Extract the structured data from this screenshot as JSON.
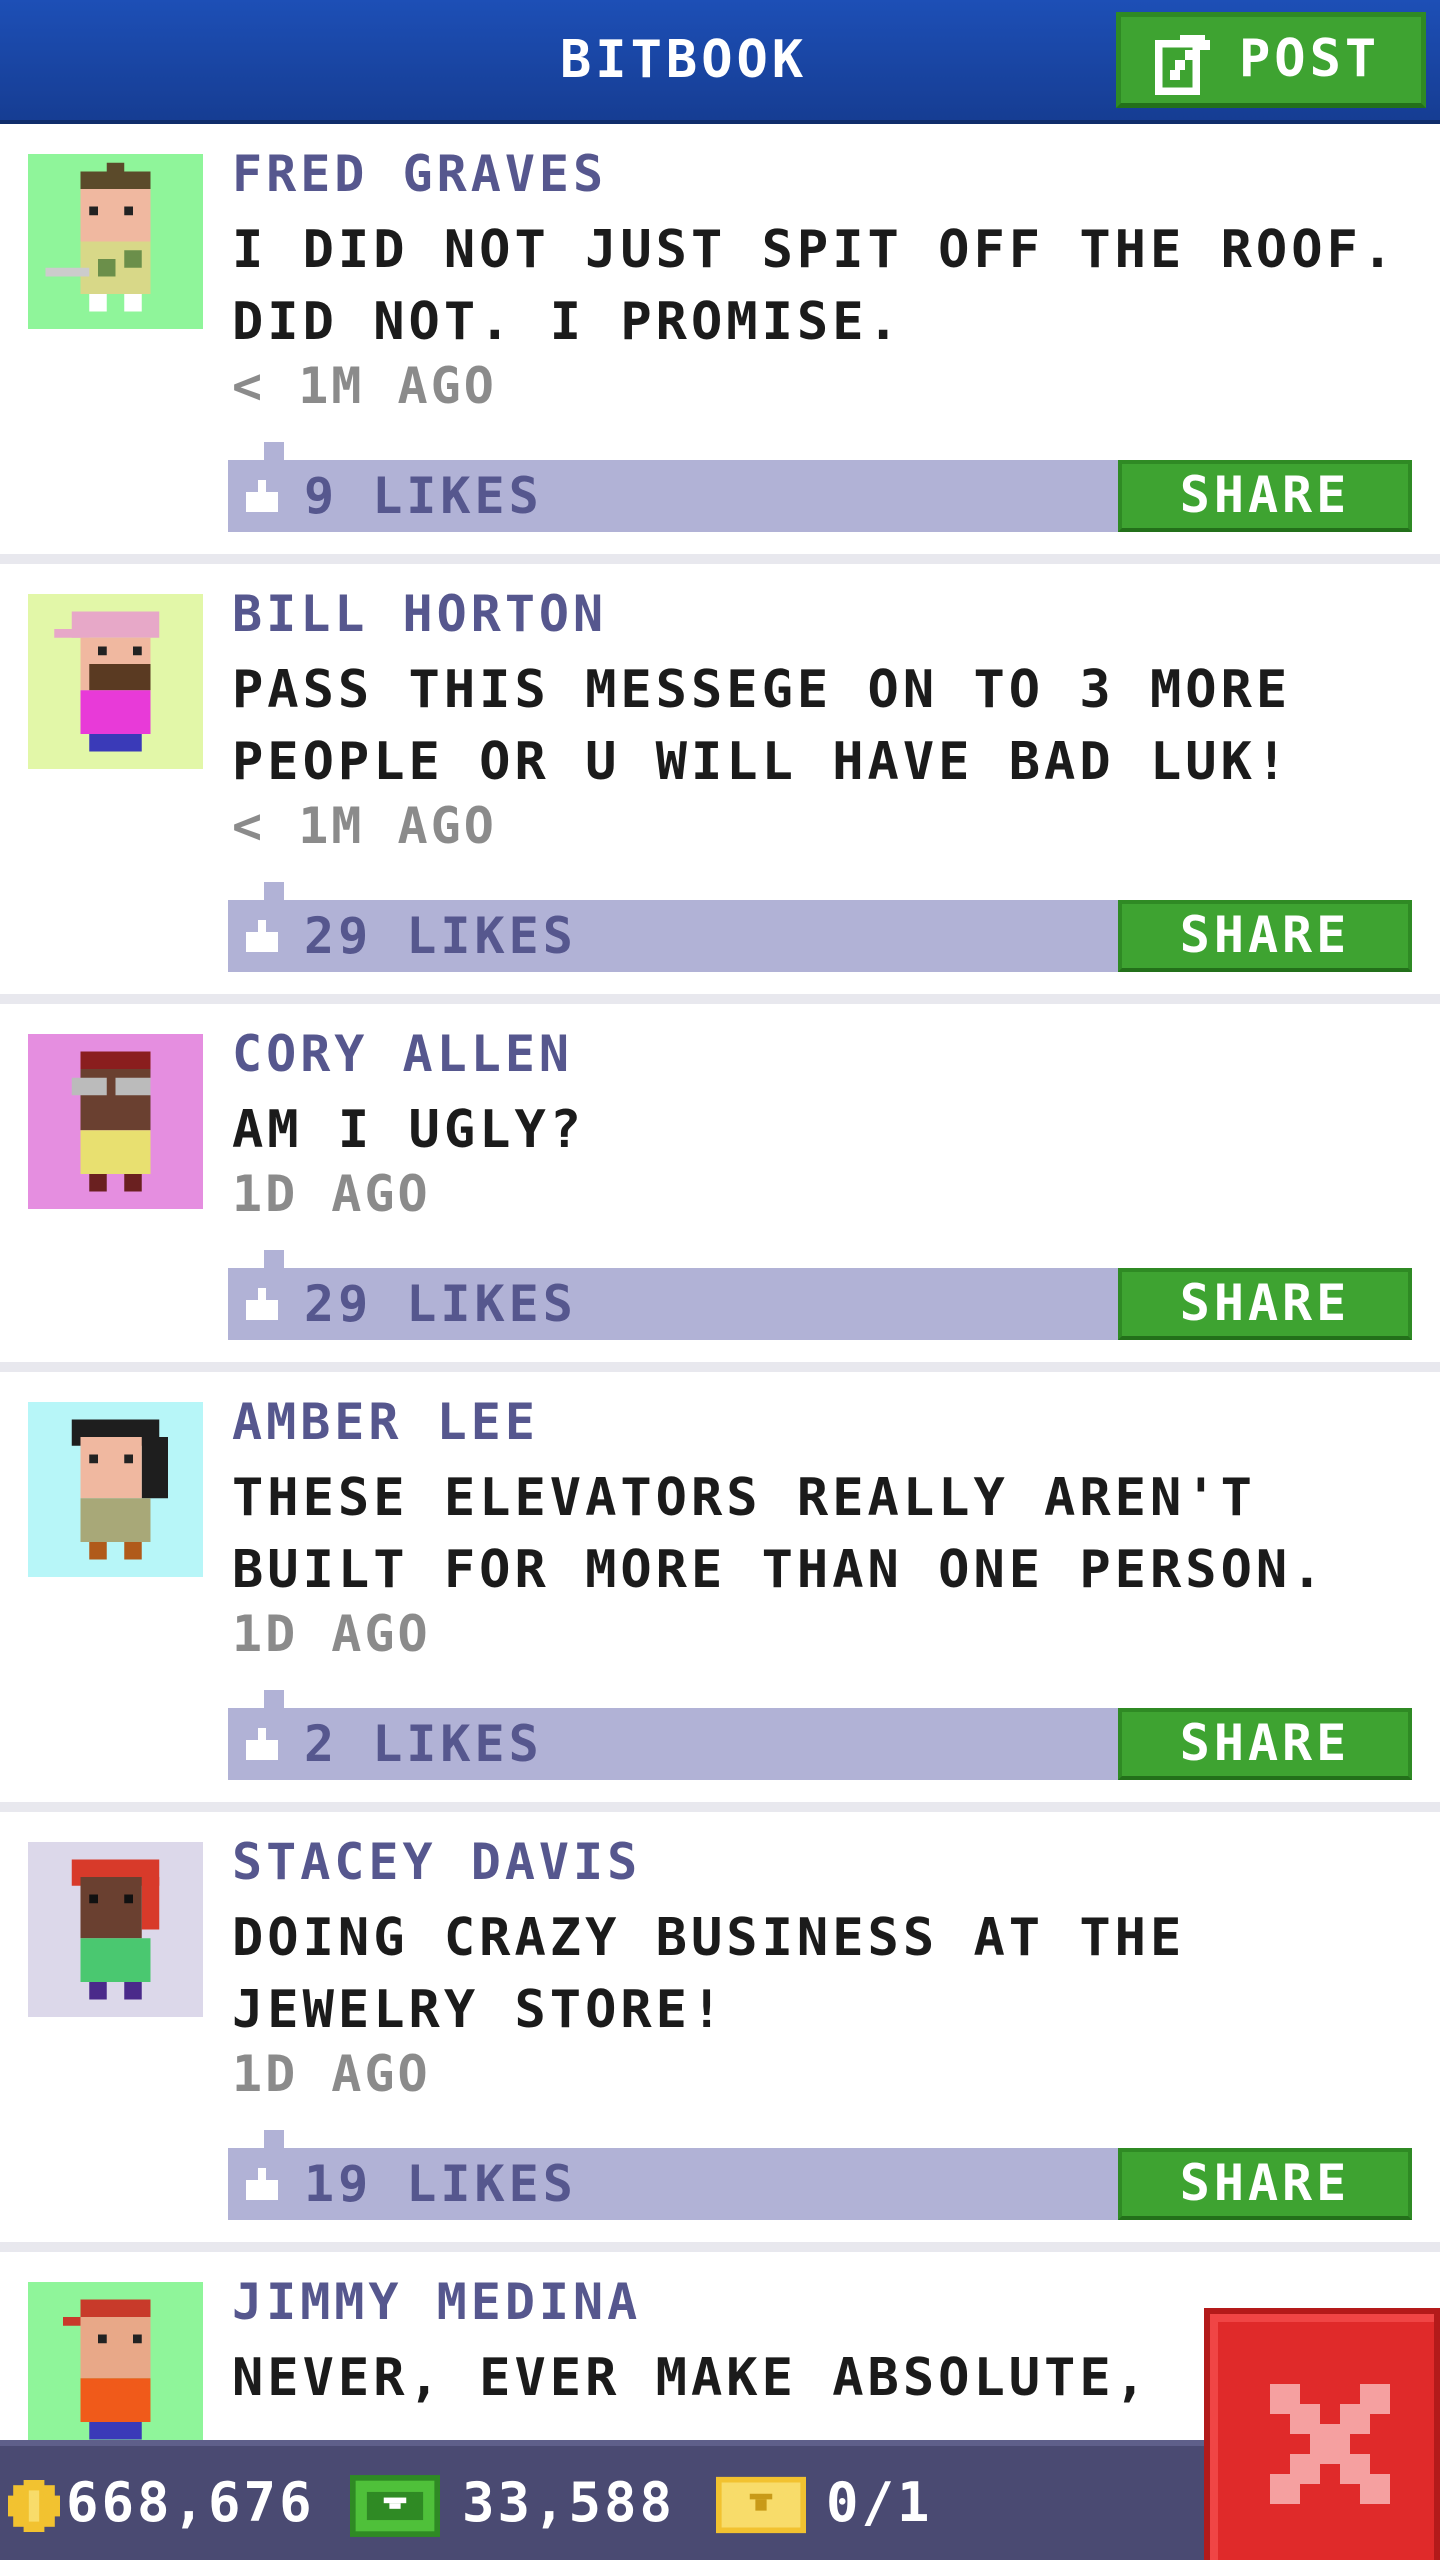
{
  "header": {
    "title": "BITBOOK",
    "post_label": "POST"
  },
  "colors": {
    "header_blue": "#1d4fb6",
    "accent_green": "#3ea331",
    "name_purple": "#56578e",
    "like_bar": "#b1b2d6",
    "close_red": "#e02a2a"
  },
  "posts": [
    {
      "author": "FRED GRAVES",
      "message": "I DID NOT JUST SPIT OFF THE ROOF. DID NOT. I PROMISE.",
      "time": "< 1M AGO",
      "likes": "9 LIKES",
      "share_label": "SHARE",
      "avatar_bg": "#8ff59a"
    },
    {
      "author": "BILL HORTON",
      "message": "PASS THIS MESSEGE ON TO 3 MORE PEOPLE OR U WILL HAVE BAD LUK!",
      "time": "< 1M AGO",
      "likes": "29 LIKES",
      "share_label": "SHARE",
      "avatar_bg": "#e2f7a8"
    },
    {
      "author": "CORY ALLEN",
      "message": "AM I UGLY?",
      "time": "1D AGO",
      "likes": "29 LIKES",
      "share_label": "SHARE",
      "avatar_bg": "#e58ee0"
    },
    {
      "author": "AMBER LEE",
      "message": "THESE ELEVATORS REALLY AREN'T BUILT FOR MORE THAN ONE PERSON.",
      "time": "1D AGO",
      "likes": "2 LIKES",
      "share_label": "SHARE",
      "avatar_bg": "#b7f6f8"
    },
    {
      "author": "STACEY DAVIS",
      "message": "DOING CRAZY BUSINESS AT THE JEWELRY STORE!",
      "time": "1D AGO",
      "likes": "19 LIKES",
      "share_label": "SHARE",
      "avatar_bg": "#dcd8ea"
    },
    {
      "author": "JIMMY MEDINA",
      "message": "NEVER, EVER MAKE ABSOLUTE,",
      "time": "",
      "likes": "",
      "share_label": "",
      "avatar_bg": "#8ff59a"
    }
  ],
  "status": {
    "coins": "668,676",
    "bux": "33,588",
    "tickets": "0/1"
  },
  "icons": {
    "post": "edit-icon",
    "like": "thumbs-up-icon",
    "coin": "coin-icon",
    "bux": "bux-icon",
    "ticket": "ticket-icon",
    "close": "close-icon"
  }
}
